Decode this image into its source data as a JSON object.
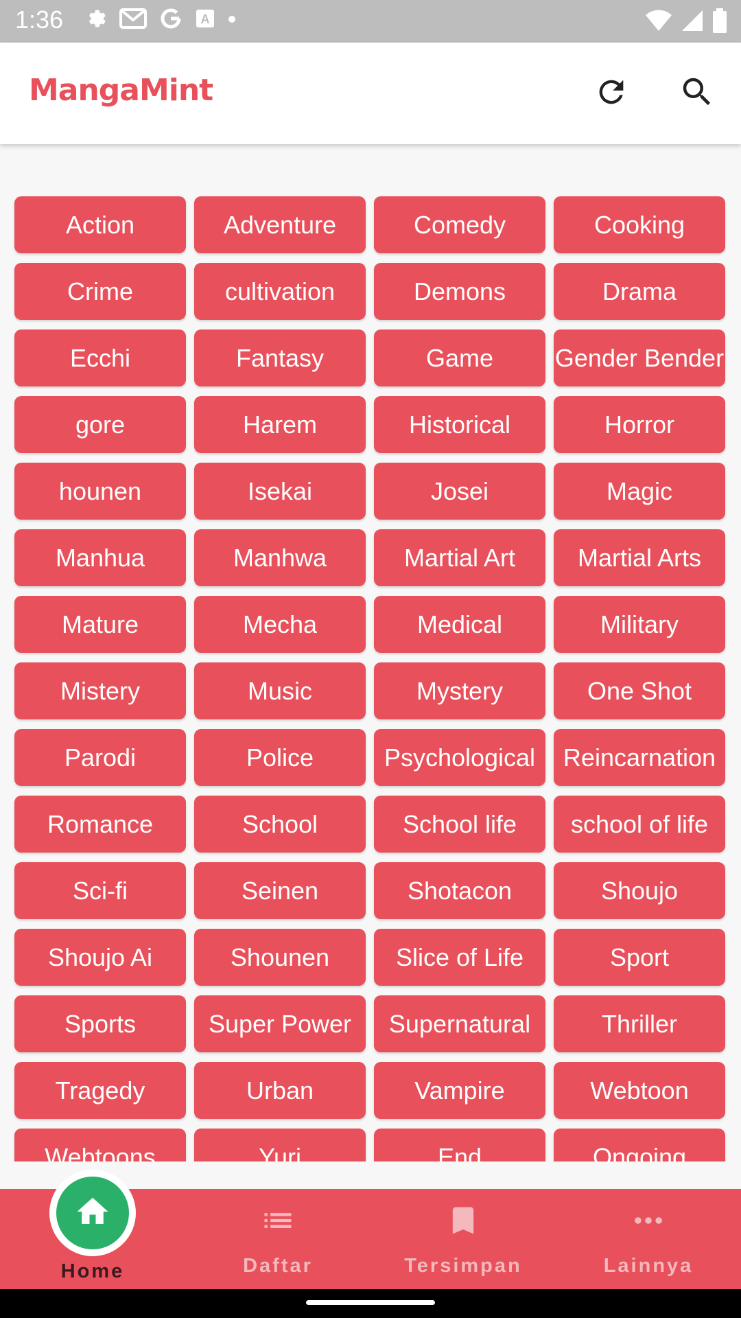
{
  "status_bar": {
    "time": "1:36"
  },
  "app_bar": {
    "logo": "MangaMint"
  },
  "genres": [
    "Action",
    "Adventure",
    "Comedy",
    "Cooking",
    "Crime",
    "cultivation",
    "Demons",
    "Drama",
    "Ecchi",
    "Fantasy",
    "Game",
    "Gender Bender",
    "gore",
    "Harem",
    "Historical",
    "Horror",
    "hounen",
    "Isekai",
    "Josei",
    "Magic",
    "Manhua",
    "Manhwa",
    "Martial Art",
    "Martial Arts",
    "Mature",
    "Mecha",
    "Medical",
    "Military",
    "Mistery",
    "Music",
    "Mystery",
    "One Shot",
    "Parodi",
    "Police",
    "Psychological",
    "Reincarnation",
    "Romance",
    "School",
    "School life",
    "school of life",
    "Sci-fi",
    "Seinen",
    "Shotacon",
    "Shoujo",
    "Shoujo Ai",
    "Shounen",
    "Slice of Life",
    "Sport",
    "Sports",
    "Super Power",
    "Supernatural",
    "Thriller",
    "Tragedy",
    "Urban",
    "Vampire",
    "Webtoon",
    "Webtoons",
    "Yuri",
    "End",
    "Ongoing"
  ],
  "bottom_nav": {
    "items": [
      {
        "label": "Home",
        "icon": "home-icon",
        "active": true
      },
      {
        "label": "Daftar",
        "icon": "list-icon",
        "active": false
      },
      {
        "label": "Tersimpan",
        "icon": "bookmark-icon",
        "active": false
      },
      {
        "label": "Lainnya",
        "icon": "more-horizontal-icon",
        "active": false
      }
    ]
  },
  "colors": {
    "accent": "#e8505b",
    "home_active": "#2bb06a",
    "status_bar": "#bdbdbd"
  }
}
